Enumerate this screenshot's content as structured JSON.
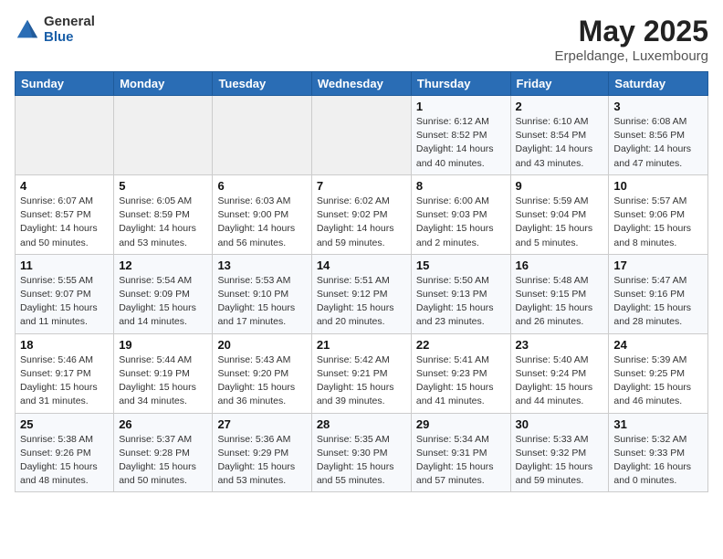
{
  "header": {
    "logo_general": "General",
    "logo_blue": "Blue",
    "month_title": "May 2025",
    "location": "Erpeldange, Luxembourg"
  },
  "days_of_week": [
    "Sunday",
    "Monday",
    "Tuesday",
    "Wednesday",
    "Thursday",
    "Friday",
    "Saturday"
  ],
  "weeks": [
    [
      {
        "day": "",
        "info": ""
      },
      {
        "day": "",
        "info": ""
      },
      {
        "day": "",
        "info": ""
      },
      {
        "day": "",
        "info": ""
      },
      {
        "day": "1",
        "info": "Sunrise: 6:12 AM\nSunset: 8:52 PM\nDaylight: 14 hours\nand 40 minutes."
      },
      {
        "day": "2",
        "info": "Sunrise: 6:10 AM\nSunset: 8:54 PM\nDaylight: 14 hours\nand 43 minutes."
      },
      {
        "day": "3",
        "info": "Sunrise: 6:08 AM\nSunset: 8:56 PM\nDaylight: 14 hours\nand 47 minutes."
      }
    ],
    [
      {
        "day": "4",
        "info": "Sunrise: 6:07 AM\nSunset: 8:57 PM\nDaylight: 14 hours\nand 50 minutes."
      },
      {
        "day": "5",
        "info": "Sunrise: 6:05 AM\nSunset: 8:59 PM\nDaylight: 14 hours\nand 53 minutes."
      },
      {
        "day": "6",
        "info": "Sunrise: 6:03 AM\nSunset: 9:00 PM\nDaylight: 14 hours\nand 56 minutes."
      },
      {
        "day": "7",
        "info": "Sunrise: 6:02 AM\nSunset: 9:02 PM\nDaylight: 14 hours\nand 59 minutes."
      },
      {
        "day": "8",
        "info": "Sunrise: 6:00 AM\nSunset: 9:03 PM\nDaylight: 15 hours\nand 2 minutes."
      },
      {
        "day": "9",
        "info": "Sunrise: 5:59 AM\nSunset: 9:04 PM\nDaylight: 15 hours\nand 5 minutes."
      },
      {
        "day": "10",
        "info": "Sunrise: 5:57 AM\nSunset: 9:06 PM\nDaylight: 15 hours\nand 8 minutes."
      }
    ],
    [
      {
        "day": "11",
        "info": "Sunrise: 5:55 AM\nSunset: 9:07 PM\nDaylight: 15 hours\nand 11 minutes."
      },
      {
        "day": "12",
        "info": "Sunrise: 5:54 AM\nSunset: 9:09 PM\nDaylight: 15 hours\nand 14 minutes."
      },
      {
        "day": "13",
        "info": "Sunrise: 5:53 AM\nSunset: 9:10 PM\nDaylight: 15 hours\nand 17 minutes."
      },
      {
        "day": "14",
        "info": "Sunrise: 5:51 AM\nSunset: 9:12 PM\nDaylight: 15 hours\nand 20 minutes."
      },
      {
        "day": "15",
        "info": "Sunrise: 5:50 AM\nSunset: 9:13 PM\nDaylight: 15 hours\nand 23 minutes."
      },
      {
        "day": "16",
        "info": "Sunrise: 5:48 AM\nSunset: 9:15 PM\nDaylight: 15 hours\nand 26 minutes."
      },
      {
        "day": "17",
        "info": "Sunrise: 5:47 AM\nSunset: 9:16 PM\nDaylight: 15 hours\nand 28 minutes."
      }
    ],
    [
      {
        "day": "18",
        "info": "Sunrise: 5:46 AM\nSunset: 9:17 PM\nDaylight: 15 hours\nand 31 minutes."
      },
      {
        "day": "19",
        "info": "Sunrise: 5:44 AM\nSunset: 9:19 PM\nDaylight: 15 hours\nand 34 minutes."
      },
      {
        "day": "20",
        "info": "Sunrise: 5:43 AM\nSunset: 9:20 PM\nDaylight: 15 hours\nand 36 minutes."
      },
      {
        "day": "21",
        "info": "Sunrise: 5:42 AM\nSunset: 9:21 PM\nDaylight: 15 hours\nand 39 minutes."
      },
      {
        "day": "22",
        "info": "Sunrise: 5:41 AM\nSunset: 9:23 PM\nDaylight: 15 hours\nand 41 minutes."
      },
      {
        "day": "23",
        "info": "Sunrise: 5:40 AM\nSunset: 9:24 PM\nDaylight: 15 hours\nand 44 minutes."
      },
      {
        "day": "24",
        "info": "Sunrise: 5:39 AM\nSunset: 9:25 PM\nDaylight: 15 hours\nand 46 minutes."
      }
    ],
    [
      {
        "day": "25",
        "info": "Sunrise: 5:38 AM\nSunset: 9:26 PM\nDaylight: 15 hours\nand 48 minutes."
      },
      {
        "day": "26",
        "info": "Sunrise: 5:37 AM\nSunset: 9:28 PM\nDaylight: 15 hours\nand 50 minutes."
      },
      {
        "day": "27",
        "info": "Sunrise: 5:36 AM\nSunset: 9:29 PM\nDaylight: 15 hours\nand 53 minutes."
      },
      {
        "day": "28",
        "info": "Sunrise: 5:35 AM\nSunset: 9:30 PM\nDaylight: 15 hours\nand 55 minutes."
      },
      {
        "day": "29",
        "info": "Sunrise: 5:34 AM\nSunset: 9:31 PM\nDaylight: 15 hours\nand 57 minutes."
      },
      {
        "day": "30",
        "info": "Sunrise: 5:33 AM\nSunset: 9:32 PM\nDaylight: 15 hours\nand 59 minutes."
      },
      {
        "day": "31",
        "info": "Sunrise: 5:32 AM\nSunset: 9:33 PM\nDaylight: 16 hours\nand 0 minutes."
      }
    ]
  ]
}
